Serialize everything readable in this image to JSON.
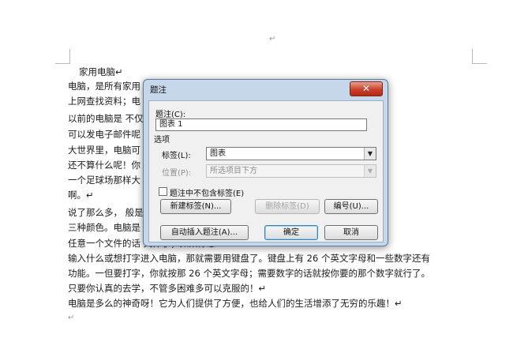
{
  "document": {
    "top_mark": "↵",
    "lines": [
      {
        "text": "家用电脑↵"
      },
      {
        "text": "电脑，是所有家用                                                            来娱乐；电脑可以"
      },
      {
        "text": "上网查找资料；电"
      },
      {
        "text": "    以前的电脑是                                                          不仅可以上网，还"
      },
      {
        "text": "可以发电子邮件呢                                                          全呢。在当今这个"
      },
      {
        "text": "大世界里，电脑可                                                          ，多得数不清。这"
      },
      {
        "text": "还不算什么呢！你                                                          一台电脑，竟然有"
      },
      {
        "text": "一个足球场那样大                                                          较，真是天壤之别"
      },
      {
        "text": "啊。↵"
      },
      {
        "text": "    说了那么多，                                                          般是银。灰。黑这"
      },
      {
        "text": "三种颜色。电脑是                                                          想打开显示屏上的"
      },
      {
        "text": "任意一个文件的话                                                          文件了；如果你想"
      },
      {
        "text": "输入什么或想打字进入电脑，那就需要用键盘了。键盘上有 26 个英文字母和一些数字还有"
      },
      {
        "text": "功能。一但要打字，你就按那 26 个英文字母；需要数字的话就按你要的那个数字就行了。"
      },
      {
        "text": "只要你认真的去学，不管多困难多可以克服的！↵"
      },
      {
        "text": "    电脑是多么的神奇呀！它为人们提供了方便，也给人们的生活增添了无穷的乐趣！↵"
      },
      {
        "text": "↵"
      }
    ]
  },
  "dialog": {
    "title": "题注",
    "close_glyph": "✕",
    "caption_label": "题注(C):",
    "caption_value": "图表 1",
    "options_label": "选项",
    "label_label": "标签(L):",
    "label_value": "图表",
    "position_label": "位置(P):",
    "position_value": "所选项目下方",
    "exclude_label_checkbox": "题注中不包含标签(E)",
    "new_label_button": "新建标签(N)...",
    "delete_label_button": "删除标签(D)",
    "numbering_button": "编号(U)...",
    "autocaption_button": "自动插入题注(A)...",
    "ok_button": "确定",
    "cancel_button": "取消"
  }
}
